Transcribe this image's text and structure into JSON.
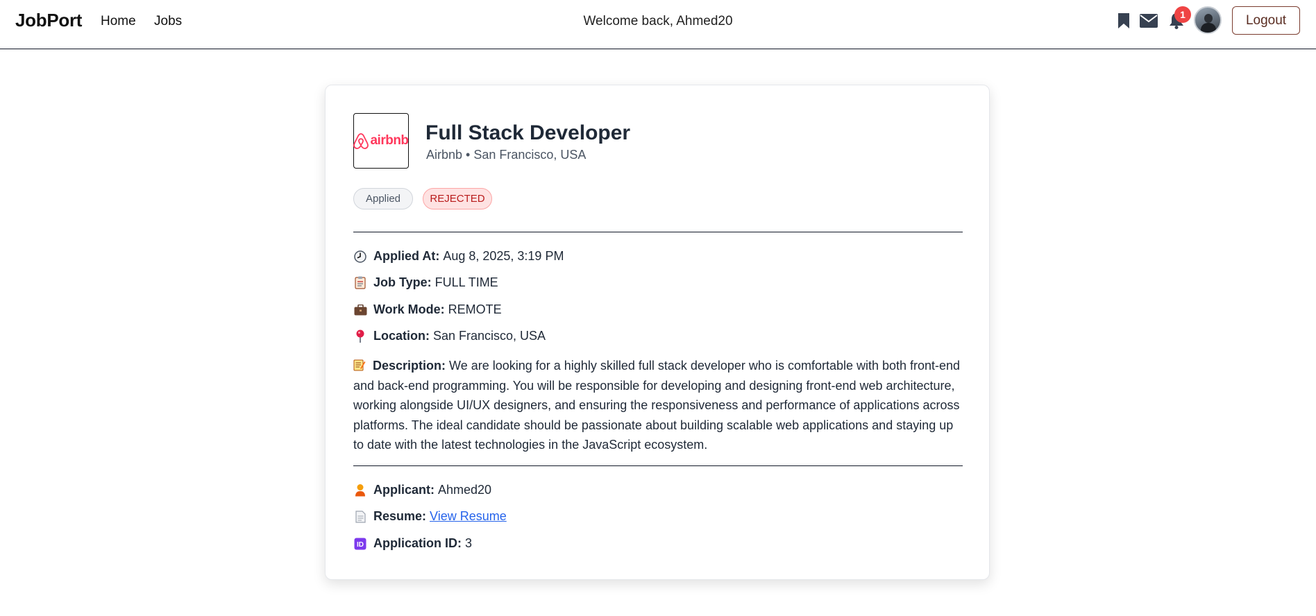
{
  "nav": {
    "brand": "JobPort",
    "links": [
      "Home",
      "Jobs"
    ],
    "welcome": "Welcome back, Ahmed20",
    "notification_count": "1",
    "logout_label": "Logout"
  },
  "job": {
    "company_logo_text": "airbnb",
    "title": "Full Stack Developer",
    "subtitle": "Airbnb • San Francisco, USA",
    "status_tags": [
      "Applied",
      "REJECTED"
    ]
  },
  "details": {
    "applied_at": {
      "label": "Applied At:",
      "value": "Aug 8, 2025, 3:19 PM"
    },
    "job_type": {
      "label": "Job Type:",
      "value": "FULL TIME"
    },
    "work_mode": {
      "label": "Work Mode:",
      "value": "REMOTE"
    },
    "location": {
      "label": "Location:",
      "value": "San Francisco, USA"
    },
    "description": {
      "label": "Description:",
      "value": "We are looking for a highly skilled full stack developer who is comfortable with both front-end and back-end programming. You will be responsible for developing and designing front-end web architecture, working alongside UI/UX designers, and ensuring the responsiveness and performance of applications across platforms. The ideal candidate should be passionate about building scalable web applications and staying up to date with the latest technologies in the JavaScript ecosystem."
    }
  },
  "applicant": {
    "applicant": {
      "label": "Applicant:",
      "value": "Ahmed20"
    },
    "resume": {
      "label": "Resume:",
      "link_text": "View Resume"
    },
    "application_id": {
      "label": "Application ID:",
      "value": "3"
    }
  },
  "icons": {
    "bookmark": "bookmark-icon",
    "mail": "envelope-icon",
    "bell": "bell-icon",
    "clock": "clock-icon",
    "clipboard": "clipboard-icon",
    "briefcase": "briefcase-icon",
    "pin": "pin-icon",
    "memo": "memo-icon",
    "person": "person-icon",
    "document": "document-icon",
    "id": "id-icon"
  },
  "colors": {
    "brand_logo": "#ff385c",
    "rejected_bg": "#fee2e2",
    "rejected_text": "#b91c1c",
    "link": "#2563eb",
    "badge": "#ef4444"
  }
}
